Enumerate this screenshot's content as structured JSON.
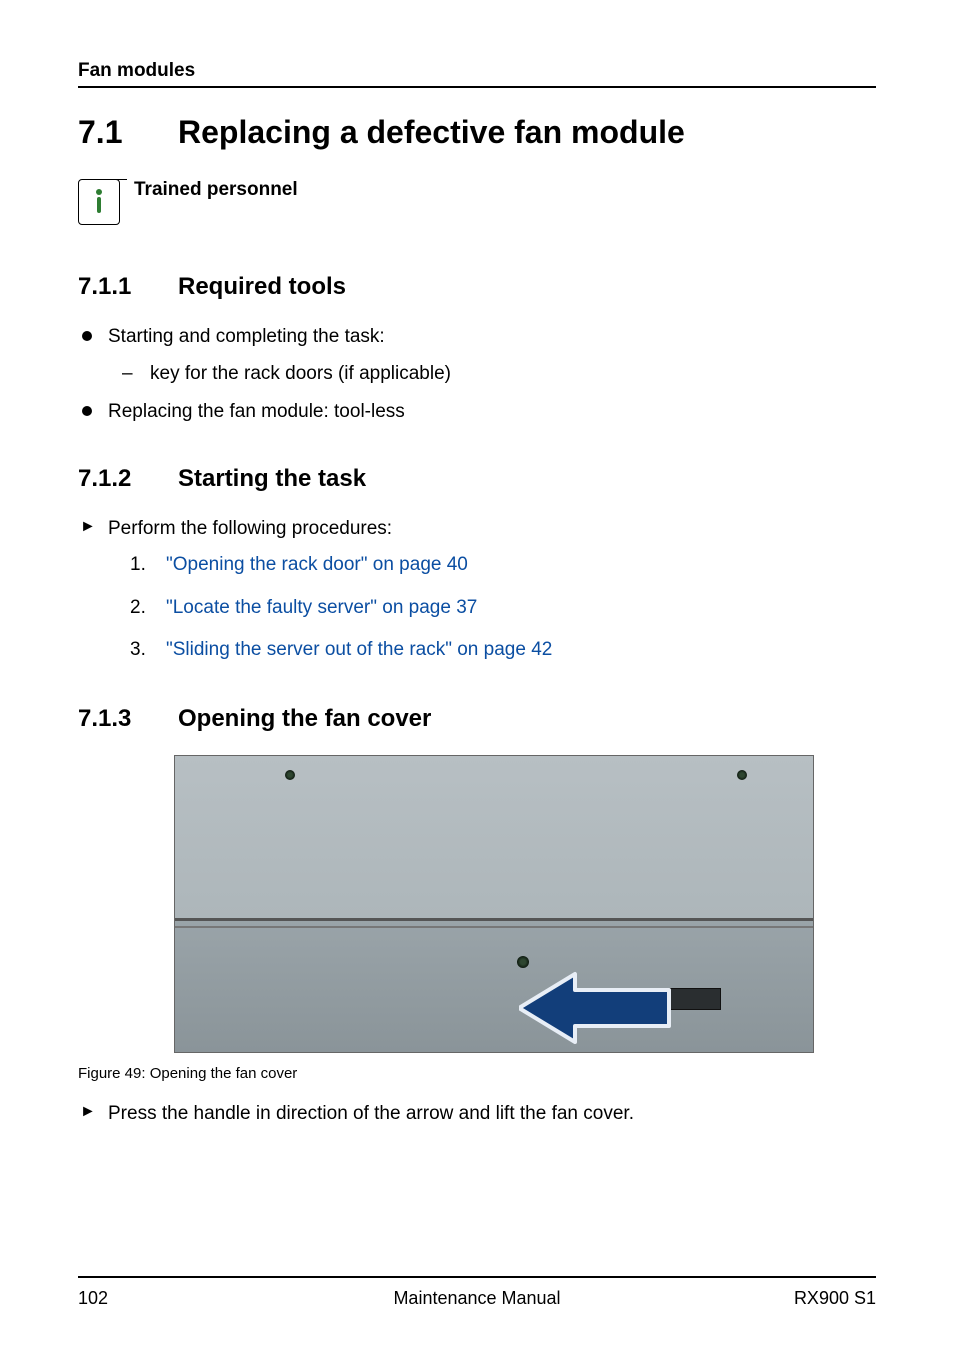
{
  "header": {
    "section": "Fan modules"
  },
  "h1": {
    "number": "7.1",
    "title": "Replacing a defective fan module"
  },
  "note": {
    "label": "Trained personnel"
  },
  "s711": {
    "number": "7.1.1",
    "title": "Required tools",
    "b1": "Starting and completing the task:",
    "b1_sub1": "key for the rack doors (if applicable)",
    "b2": "Replacing the fan module: tool-less"
  },
  "s712": {
    "number": "7.1.2",
    "title": "Starting the task",
    "intro": "Perform the following procedures:",
    "step1": "\"Opening the rack door\" on page 40",
    "step2": "\"Locate the faulty server\" on page 37",
    "step3": "\"Sliding the server out of the rack\" on page 42"
  },
  "s713": {
    "number": "7.1.3",
    "title": "Opening the fan cover",
    "caption": "Figure 49: Opening the fan cover",
    "action": "Press the handle in direction of the arrow and lift the fan cover."
  },
  "footer": {
    "page": "102",
    "center": "Maintenance Manual",
    "right": "RX900 S1"
  }
}
